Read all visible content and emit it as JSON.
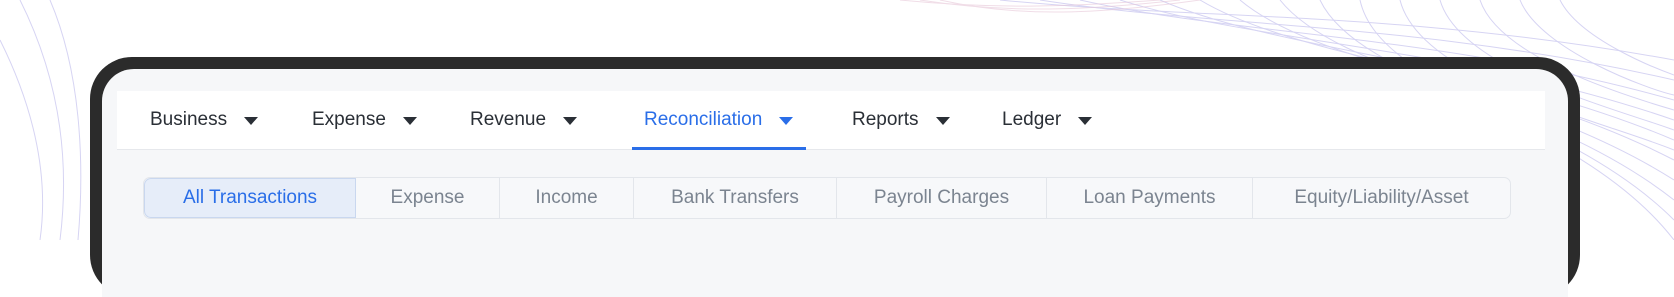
{
  "theme": {
    "accent": "#2a6ee8",
    "frame": "#2b2b2b",
    "text": "#2a2f36",
    "muted": "#7b8490"
  },
  "topnav": {
    "items": [
      {
        "label": "Business",
        "icon": "caret-down-icon"
      },
      {
        "label": "Expense",
        "icon": "caret-down-icon"
      },
      {
        "label": "Revenue",
        "icon": "caret-down-icon"
      },
      {
        "label": "Reconciliation",
        "icon": "caret-down-icon",
        "active": true
      },
      {
        "label": "Reports",
        "icon": "caret-down-icon"
      },
      {
        "label": "Ledger",
        "icon": "caret-down-icon"
      }
    ]
  },
  "subtabs": {
    "items": [
      {
        "label": "All Transactions",
        "active": true
      },
      {
        "label": "Expense"
      },
      {
        "label": "Income"
      },
      {
        "label": "Bank Transfers"
      },
      {
        "label": "Payroll Charges"
      },
      {
        "label": "Loan Payments"
      },
      {
        "label": "Equity/Liability/Asset"
      }
    ]
  }
}
